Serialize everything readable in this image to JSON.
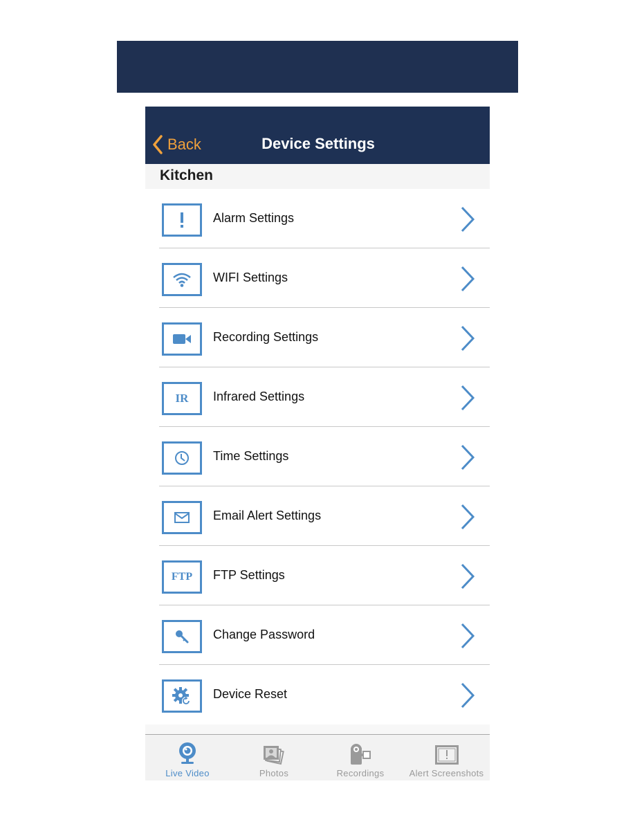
{
  "colors": {
    "navbar": "#1e3154",
    "back_accent": "#f0a13c",
    "icon_accent": "#4d8cc8",
    "tab_inactive": "#9a9a9a"
  },
  "navbar": {
    "back_label": "Back",
    "back_icon": "chevron-left-icon",
    "title": "Device Settings"
  },
  "section": {
    "title": "Kitchen"
  },
  "settings": [
    {
      "label": "Alarm Settings",
      "icon": "alert-icon"
    },
    {
      "label": "WIFI Settings",
      "icon": "wifi-icon"
    },
    {
      "label": "Recording Settings",
      "icon": "video-camera-icon"
    },
    {
      "label": "Infrared Settings",
      "icon": "infrared-icon",
      "icon_text": "IR"
    },
    {
      "label": "Time Settings",
      "icon": "clock-icon"
    },
    {
      "label": "Email Alert Settings",
      "icon": "envelope-icon"
    },
    {
      "label": "FTP Settings",
      "icon": "ftp-icon",
      "icon_text": "FTP"
    },
    {
      "label": "Change Password",
      "icon": "key-icon"
    },
    {
      "label": "Device Reset",
      "icon": "gear-reset-icon"
    }
  ],
  "tabbar": {
    "tabs": [
      {
        "label": "Live Video",
        "icon": "webcam-icon",
        "active": true
      },
      {
        "label": "Photos",
        "icon": "photos-icon",
        "active": false
      },
      {
        "label": "Recordings",
        "icon": "camcorder-icon",
        "active": false
      },
      {
        "label": "Alert Screenshots",
        "icon": "alert-screenshot-icon",
        "active": false
      }
    ]
  }
}
